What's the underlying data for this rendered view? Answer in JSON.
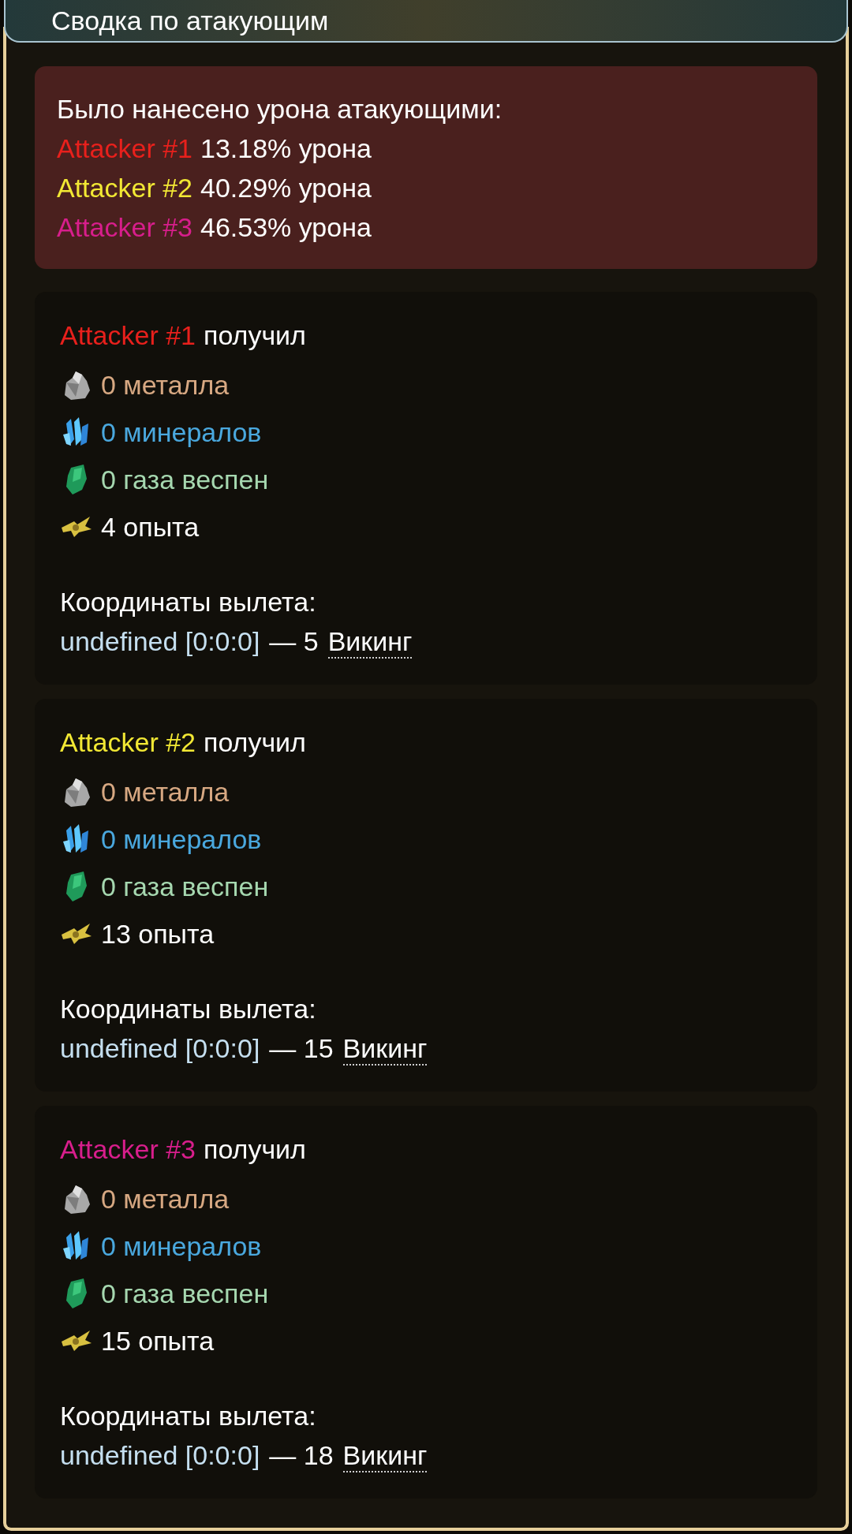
{
  "title": "Сводка по атакующим",
  "summary": {
    "heading": "Было нанесено урона атакующими:",
    "rows": [
      {
        "attacker": "Attacker #1",
        "color": "#e8201c",
        "share": "13.18% урона"
      },
      {
        "attacker": "Attacker #2",
        "color": "#f2e834",
        "share": "40.29% урона"
      },
      {
        "attacker": "Attacker #3",
        "color": "#d81e8c",
        "share": "46.53% урона"
      }
    ]
  },
  "attackers": [
    {
      "name": "Attacker #1",
      "color": "#e8201c",
      "verb": "получил",
      "resources": [
        {
          "kind": "metal",
          "text": "0 металла"
        },
        {
          "kind": "crystal",
          "text": "0 минералов"
        },
        {
          "kind": "gas",
          "text": "0 газа веспен"
        },
        {
          "kind": "xp",
          "text": "4 опыта"
        }
      ],
      "departure_label": "Координаты вылета:",
      "origin": "undefined [0:0:0]",
      "count": "— 5",
      "ship": "Викинг"
    },
    {
      "name": "Attacker #2",
      "color": "#f2e834",
      "verb": "получил",
      "resources": [
        {
          "kind": "metal",
          "text": "0 металла"
        },
        {
          "kind": "crystal",
          "text": "0 минералов"
        },
        {
          "kind": "gas",
          "text": "0 газа веспен"
        },
        {
          "kind": "xp",
          "text": "13 опыта"
        }
      ],
      "departure_label": "Координаты вылета:",
      "origin": "undefined [0:0:0]",
      "count": "— 15",
      "ship": "Викинг"
    },
    {
      "name": "Attacker #3",
      "color": "#d81e8c",
      "verb": "получил",
      "resources": [
        {
          "kind": "metal",
          "text": "0 металла"
        },
        {
          "kind": "crystal",
          "text": "0 минералов"
        },
        {
          "kind": "gas",
          "text": "0 газа веспен"
        },
        {
          "kind": "xp",
          "text": "15 опыта"
        }
      ],
      "departure_label": "Координаты вылета:",
      "origin": "undefined [0:0:0]",
      "count": "— 18",
      "ship": "Викинг"
    }
  ]
}
